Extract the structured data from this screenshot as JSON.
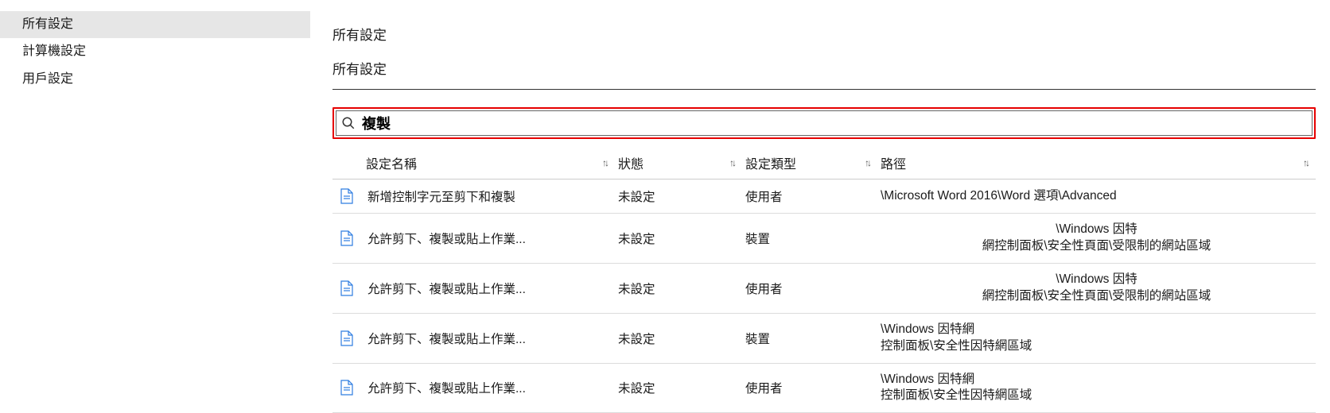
{
  "sidebar": {
    "items": [
      {
        "label": "所有設定",
        "selected": true
      },
      {
        "label": "計算機設定",
        "selected": false
      },
      {
        "label": "用戶設定",
        "selected": false
      }
    ]
  },
  "header": {
    "title": "所有設定",
    "subtitle": "所有設定"
  },
  "search": {
    "value": "複製",
    "icon": "search-icon"
  },
  "table": {
    "columns": {
      "name": "設定名稱",
      "state": "狀態",
      "type": "設定類型",
      "path": "路徑"
    },
    "rows": [
      {
        "name": "新增控制字元至剪下和複製",
        "state": "未設定",
        "type": "使用者",
        "path": "\\Microsoft Word 2016\\Word 選項\\Advanced",
        "path_align": "left"
      },
      {
        "name": "允許剪下、複製或貼上作業...",
        "state": "未設定",
        "type": "裝置",
        "path": "\\Windows 因特\n網控制面板\\安全性頁面\\受限制的網站區域",
        "path_align": "center"
      },
      {
        "name": "允許剪下、複製或貼上作業...",
        "state": "未設定",
        "type": "使用者",
        "path": "\\Windows 因特\n網控制面板\\安全性頁面\\受限制的網站區域",
        "path_align": "center"
      },
      {
        "name": "允許剪下、複製或貼上作業...",
        "state": "未設定",
        "type": "裝置",
        "path": "\\Windows 因特網\n控制面板\\安全性因特網區域",
        "path_align": "left"
      },
      {
        "name": "允許剪下、複製或貼上作業...",
        "state": "未設定",
        "type": "使用者",
        "path": "\\Windows 因特網\n控制面板\\安全性因特網區域",
        "path_align": "left"
      }
    ]
  }
}
